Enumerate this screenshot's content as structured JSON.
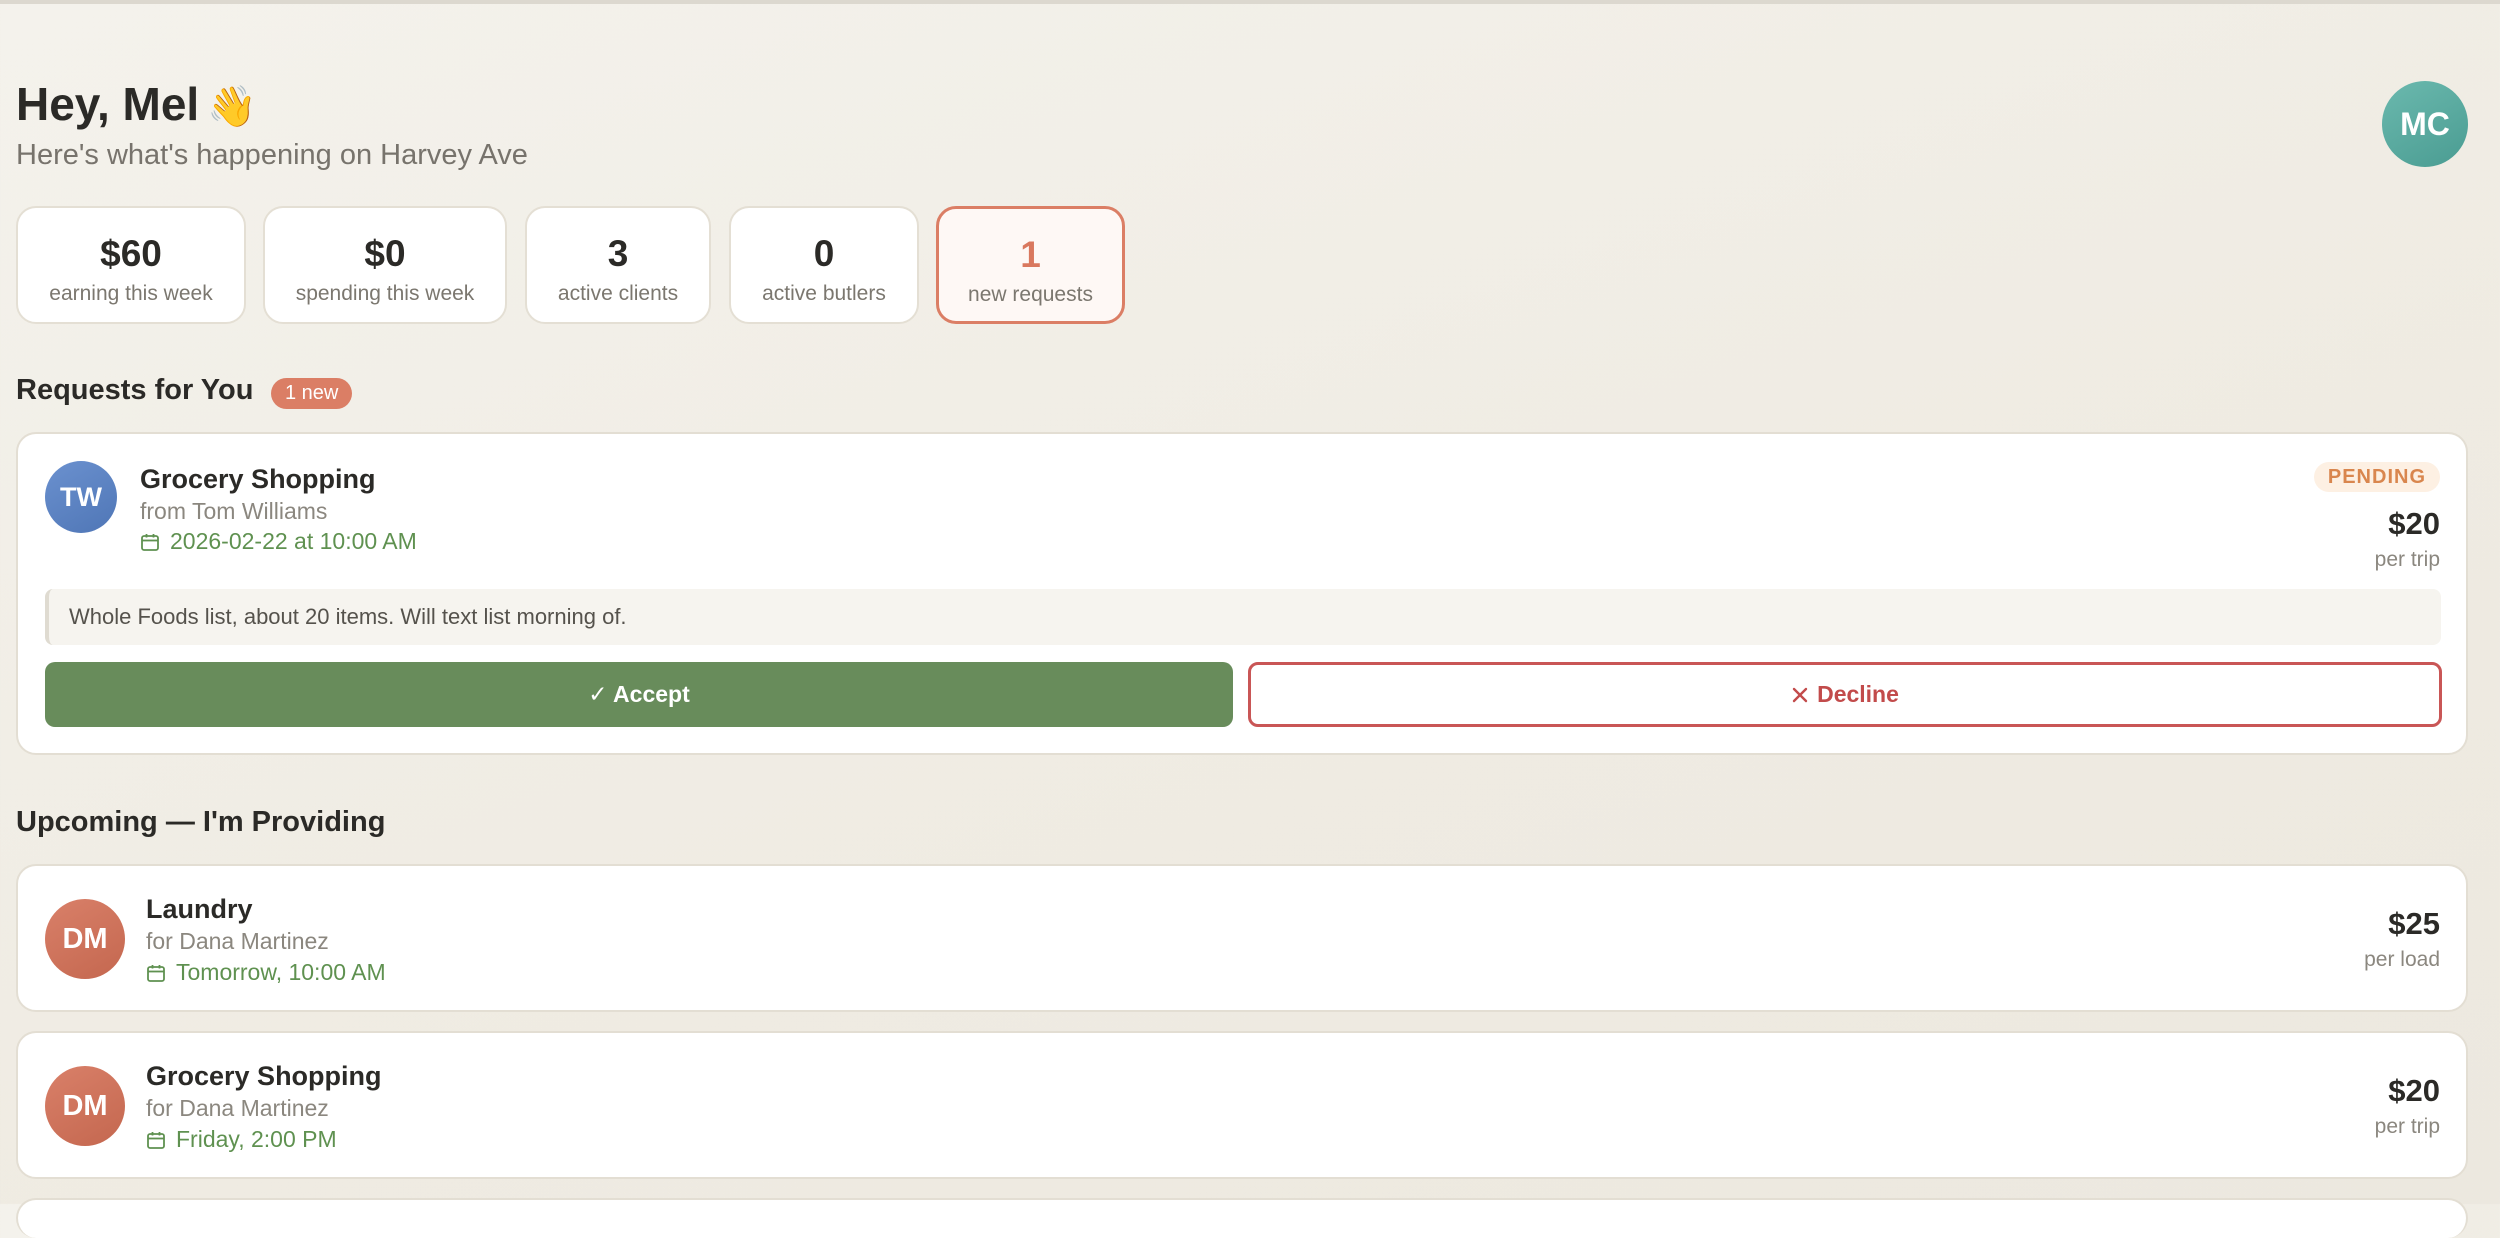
{
  "header": {
    "greeting": "Hey, Mel",
    "wave_icon": "👋",
    "subtitle": "Here's what's happening on Harvey Ave",
    "avatar_initials": "MC"
  },
  "stats": [
    {
      "value": "$60",
      "label": "earning this week"
    },
    {
      "value": "$0",
      "label": "spending this week"
    },
    {
      "value": "3",
      "label": "active clients"
    },
    {
      "value": "0",
      "label": "active butlers"
    },
    {
      "value": "1",
      "label": "new requests"
    }
  ],
  "requests": {
    "title": "Requests for You",
    "badge": "1 new",
    "items": [
      {
        "initials": "TW",
        "title": "Grocery Shopping",
        "from": "from Tom Williams",
        "date": "2026-02-22 at 10:00 AM",
        "status": "PENDING",
        "price": "$20",
        "unit": "per trip",
        "note": "Whole Foods list, about 20 items. Will text list morning of.",
        "accept_label": "✓ Accept",
        "decline_label": "Decline"
      }
    ]
  },
  "upcoming": {
    "title": "Upcoming — I'm Providing",
    "items": [
      {
        "initials": "DM",
        "title": "Laundry",
        "for": "for Dana Martinez",
        "date": "Tomorrow, 10:00 AM",
        "price": "$25",
        "unit": "per load"
      },
      {
        "initials": "DM",
        "title": "Grocery Shopping",
        "for": "for Dana Martinez",
        "date": "Friday, 2:00 PM",
        "price": "$20",
        "unit": "per trip"
      }
    ]
  },
  "colors": {
    "accent_green": "#688c5b",
    "accent_coral": "#db7e65",
    "decline_red": "#c95656",
    "avatar_teal": "#4a9c92",
    "avatar_blue": "#5a80c0",
    "avatar_red": "#cc6f57"
  }
}
